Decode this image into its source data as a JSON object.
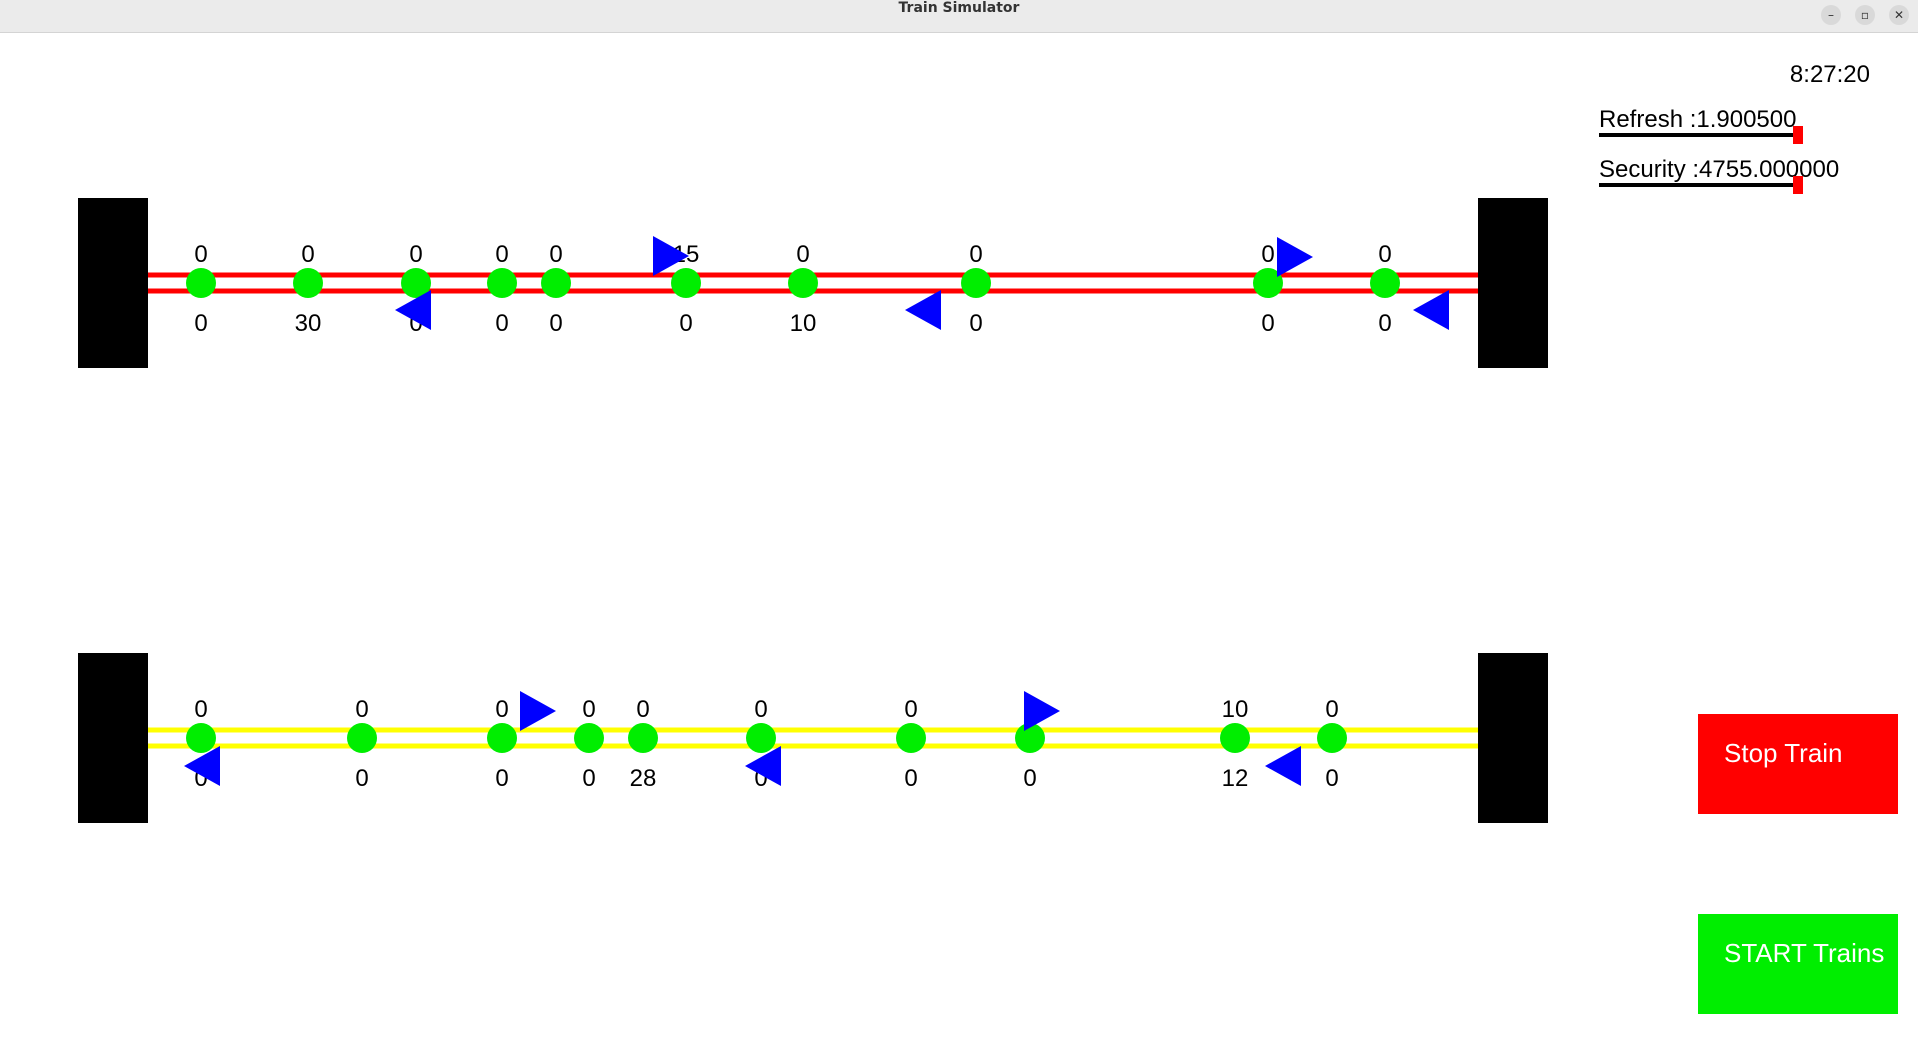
{
  "window": {
    "title": "Train Simulator",
    "controls": [
      "minimize-icon",
      "restore-icon",
      "close-icon"
    ]
  },
  "clock": "8:27:20",
  "refresh": {
    "label": "Refresh :1.900500",
    "level": 1.0
  },
  "security": {
    "label": "Security :4755.000000",
    "level": 1.0
  },
  "buttons": {
    "stop": "Stop Train",
    "start": "START Trains"
  },
  "colors": {
    "track_top": "#ff0000",
    "track_bottom": "#ffff00",
    "station": "#00ee00",
    "train": "#0000ff",
    "terminal": "#000000",
    "stop_button": "#ff0000",
    "start_button": "#00ee00",
    "slider_marker": "#ff0000"
  },
  "tracks": [
    {
      "name": "track-top",
      "stations": [
        {
          "top": "0",
          "bottom": "0"
        },
        {
          "top": "0",
          "bottom": "30"
        },
        {
          "top": "0",
          "bottom": "0"
        },
        {
          "top": "0",
          "bottom": "0"
        },
        {
          "top": "0",
          "bottom": "0"
        },
        {
          "top": "15",
          "bottom": "0"
        },
        {
          "top": "0",
          "bottom": "10"
        },
        {
          "top": "0",
          "bottom": "0"
        },
        {
          "top": "0",
          "bottom": "0"
        },
        {
          "top": "0",
          "bottom": "0"
        }
      ],
      "trains": [
        {
          "direction": "right",
          "lane": "upper"
        },
        {
          "direction": "right",
          "lane": "upper"
        },
        {
          "direction": "left",
          "lane": "lower"
        },
        {
          "direction": "left",
          "lane": "lower"
        },
        {
          "direction": "left",
          "lane": "lower"
        }
      ]
    },
    {
      "name": "track-bottom",
      "stations": [
        {
          "top": "0",
          "bottom": "0"
        },
        {
          "top": "0",
          "bottom": "0"
        },
        {
          "top": "0",
          "bottom": "0"
        },
        {
          "top": "0",
          "bottom": "0"
        },
        {
          "top": "0",
          "bottom": "28"
        },
        {
          "top": "0",
          "bottom": "0"
        },
        {
          "top": "0",
          "bottom": "0"
        },
        {
          "top": "0",
          "bottom": "0"
        },
        {
          "top": "10",
          "bottom": "12"
        },
        {
          "top": "0",
          "bottom": "0"
        }
      ],
      "trains": [
        {
          "direction": "right",
          "lane": "upper"
        },
        {
          "direction": "right",
          "lane": "upper"
        },
        {
          "direction": "left",
          "lane": "lower"
        },
        {
          "direction": "left",
          "lane": "lower"
        },
        {
          "direction": "left",
          "lane": "lower"
        }
      ]
    }
  ]
}
